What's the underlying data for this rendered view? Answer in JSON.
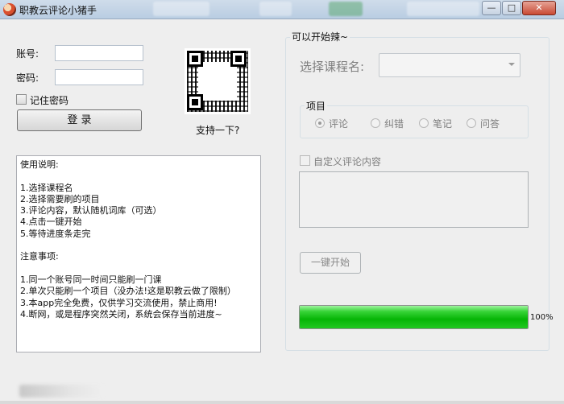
{
  "window": {
    "title": "职教云评论小猪手",
    "minimize_icon": "minimize-icon",
    "maximize_icon": "maximize-icon",
    "close_icon": "close-icon"
  },
  "login": {
    "account_label": "账号:",
    "account_value": "",
    "password_label": "密码:",
    "password_value": "",
    "remember_label": "记住密码",
    "remember_checked": false,
    "login_button": "登 录"
  },
  "qr": {
    "caption": "支持一下?"
  },
  "instructions": {
    "lines": [
      "使用说明:",
      "",
      "1.选择课程名",
      "2.选择需要刷的项目",
      "3.评论内容，默认随机词库（可选）",
      "4.点击一键开始",
      "5.等待进度条走完",
      "",
      "注意事项:",
      "",
      "1.同一个账号同一时间只能刷一门课",
      "2.单次只能刷一个项目（没办法!这是职教云做了限制）",
      "3.本app完全免费，仅供学习交流使用，禁止商用!",
      "4.断网，或是程序突然关闭，系统会保存当前进度~"
    ]
  },
  "panel": {
    "title": "可以开始辣~",
    "course_label": "选择课程名:",
    "course_selected": "",
    "items_group_label": "项目",
    "options": [
      "评论",
      "纠错",
      "笔记",
      "问答"
    ],
    "selected_option": "评论",
    "custom_comment_label": "自定义评论内容",
    "custom_comment_value": "",
    "start_button": "一键开始",
    "progress_percent": 100,
    "progress_text": "100%"
  },
  "colors": {
    "progress_green": "#06b506",
    "titlebar": "#c4d4e6"
  }
}
